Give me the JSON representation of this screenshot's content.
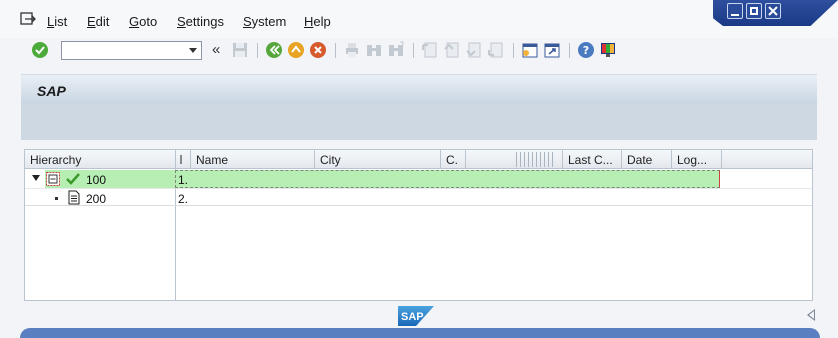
{
  "menu": {
    "items": [
      {
        "label": "List",
        "u": "L",
        "rest": "ist"
      },
      {
        "label": "Edit",
        "u": "E",
        "rest": "dit"
      },
      {
        "label": "Goto",
        "u": "G",
        "rest": "oto"
      },
      {
        "label": "Settings",
        "u": "S",
        "rest": "ettings"
      },
      {
        "label": "System",
        "u": "S",
        "rest": "ystem"
      },
      {
        "label": "Help",
        "u": "H",
        "rest": "elp"
      }
    ]
  },
  "toolbar": {
    "command_value": "",
    "back_glyph": "«"
  },
  "title": "SAP",
  "grid": {
    "columns": [
      "Hierarchy",
      "",
      "Name",
      "City",
      "C.",
      "",
      "Last C...",
      "Date",
      "Log..."
    ],
    "rows": [
      {
        "id": "100",
        "name": "1.",
        "expanded": true,
        "status": "check"
      },
      {
        "id": "200",
        "name": "2.",
        "expanded": false,
        "status": "document"
      }
    ]
  },
  "colors": {
    "selected_row": "#b7eeb3",
    "accent": "#1a3a86"
  }
}
